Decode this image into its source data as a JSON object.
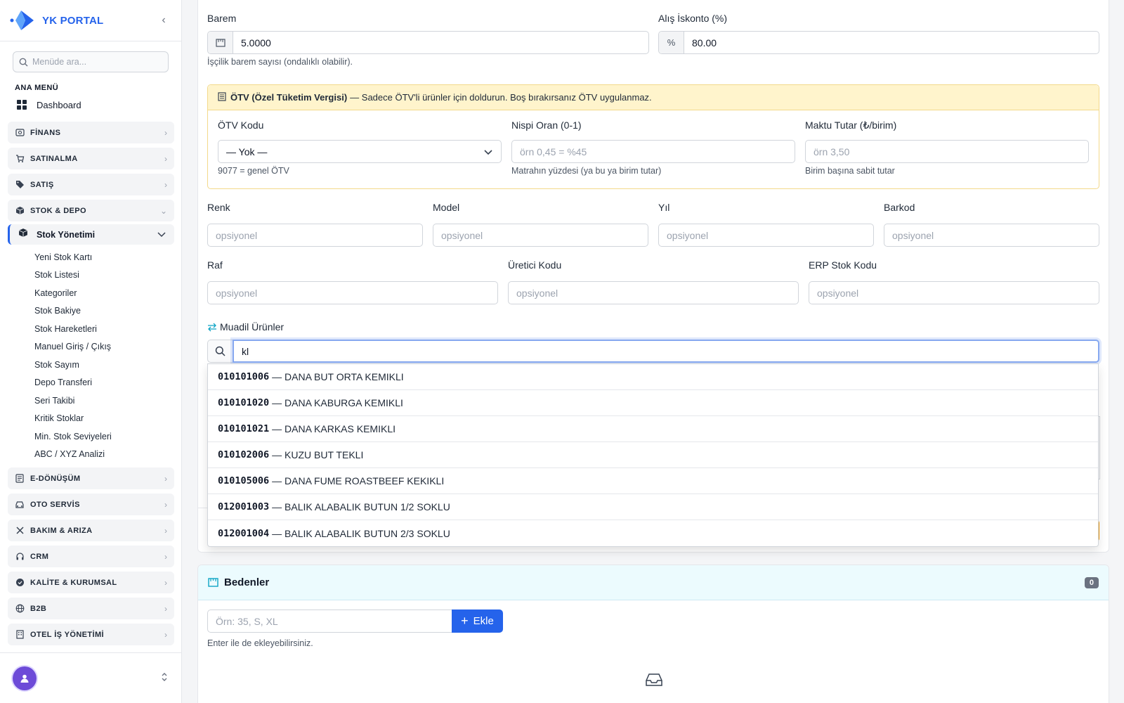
{
  "sidebar": {
    "brand": "YK PORTAL",
    "search_placeholder": "Menüde ara...",
    "section": "ANA MENÜ",
    "dashboard": "Dashboard",
    "groups": [
      {
        "label": "FİNANS",
        "icon": "finance-icon"
      },
      {
        "label": "SATINALMA",
        "icon": "cart-icon"
      },
      {
        "label": "SATIŞ",
        "icon": "tag-icon"
      },
      {
        "label": "STOK & DEPO",
        "icon": "box-icon"
      }
    ],
    "stock_group": "Stok Yönetimi",
    "stock_items": [
      "Yeni Stok Kartı",
      "Stok Listesi",
      "Kategoriler",
      "Stok Bakiye",
      "Stok Hareketleri",
      "Manuel Giriş / Çıkış",
      "Stok Sayım",
      "Depo Transferi",
      "Seri Takibi",
      "Kritik Stoklar",
      "Min. Stok Seviyeleri",
      "ABC / XYZ Analizi"
    ],
    "groups_after": [
      {
        "label": "E-DÖNÜŞÜM",
        "icon": "document-icon"
      },
      {
        "label": "OTO SERVİS",
        "icon": "car-icon"
      },
      {
        "label": "BAKIM & ARIZA",
        "icon": "tools-icon"
      },
      {
        "label": "CRM",
        "icon": "headset-icon"
      },
      {
        "label": "KALİTE & KURUMSAL",
        "icon": "badge-check-icon"
      },
      {
        "label": "B2B",
        "icon": "globe-icon"
      },
      {
        "label": "OTEL İŞ YÖNETİMİ",
        "icon": "building-icon"
      }
    ]
  },
  "form": {
    "barem": {
      "label": "Barem",
      "value": "5.0000",
      "hint": "İşçilik barem sayısı (ondalıklı olabilir)."
    },
    "iskonto": {
      "label": "Alış İskonto (%)",
      "addon": "%",
      "value": "80.00"
    },
    "otv": {
      "title": "ÖTV (Özel Tüketim Vergisi)",
      "note": "— Sadece ÖTV'li ürünler için doldurun. Boş bırakırsanız ÖTV uygulanmaz.",
      "kod_label": "ÖTV Kodu",
      "kod_value": "— Yok —",
      "kod_hint": "9077 = genel ÖTV",
      "oran_label": "Nispi Oran (0-1)",
      "oran_placeholder": "örn 0,45 = %45",
      "oran_hint": "Matrahın yüzdesi (ya bu ya birim tutar)",
      "maktu_label": "Maktu Tutar (₺/birim)",
      "maktu_placeholder": "örn 3,50",
      "maktu_hint": "Birim başına sabit tutar"
    },
    "optional_placeholder": "opsiyonel",
    "row1": [
      "Renk",
      "Model",
      "Yıl",
      "Barkod"
    ],
    "row2": [
      "Raf",
      "Üretici Kodu",
      "ERP Stok Kodu"
    ],
    "muadil": {
      "label": "Muadil Ürünler",
      "query": "kl",
      "results": [
        {
          "code": "010101006",
          "name": "— DANA BUT ORTA KEMIKLI"
        },
        {
          "code": "010101020",
          "name": "— DANA KABURGA KEMIKLI"
        },
        {
          "code": "010101021",
          "name": "— DANA KARKAS KEMIKLI"
        },
        {
          "code": "010102006",
          "name": "— KUZU BUT TEKLI"
        },
        {
          "code": "010105006",
          "name": "— DANA FUME ROASTBEEF KEKIKLI"
        },
        {
          "code": "012001003",
          "name": "— BALIK ALABALIK BUTUN 1/2 SOKLU"
        },
        {
          "code": "012001004",
          "name": "— BALIK ALABALIK BUTUN 2/3 SOKLU"
        }
      ]
    }
  },
  "bedenler": {
    "title": "Bedenler",
    "count": "0",
    "placeholder": "Örn: 35, S, XL",
    "add_label": "Ekle",
    "hint": "Enter ile de ekleyebilirsiniz."
  },
  "colors": {
    "accent": "#2563eb",
    "warning_bg": "#fff4cc",
    "info_bg": "#ecfbfe"
  }
}
